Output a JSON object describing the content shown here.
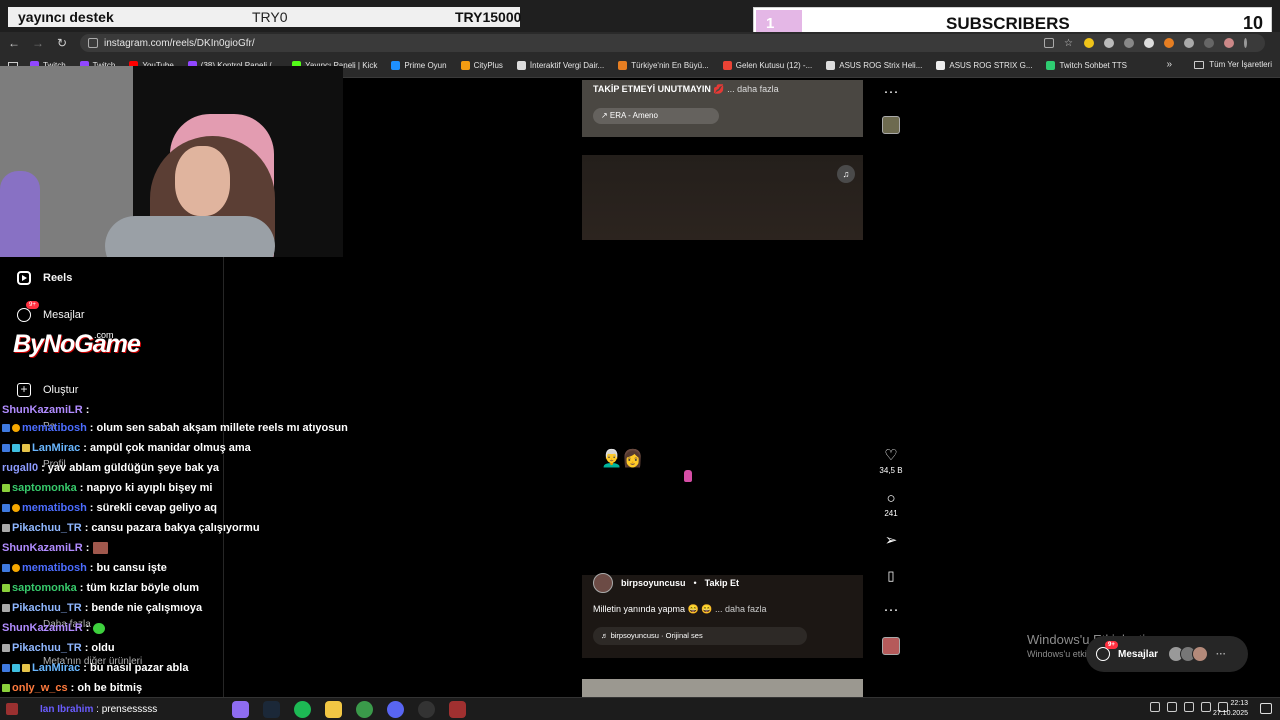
{
  "browser": {
    "url": "instagram.com/reels/DKIn0gioGfr/",
    "bookmarks": [
      "Twitch",
      "Twitch",
      "YouTube",
      "(38) Kontrol Paneli /...",
      "Yayıncı Paneli | Kick",
      "Prime Oyun",
      "CityPlus",
      "İnteraktif Vergi Dair...",
      "Türkiye'nin En Büyü...",
      "Gelen Kutusu (12) -...",
      "ASUS ROG Strix Heli...",
      "ASUS ROG STRIX G...",
      "Twitch Sohbet TTS"
    ],
    "all_bookmarks": "Tüm Yer İşaretleri",
    "more": "»"
  },
  "overlay": {
    "donor_label": "yayıncı destek",
    "donor_amount": "TRY0",
    "donor_goal": "TRY15000",
    "subs_count_left": "1",
    "subs_label": "SUBSCRIBERS",
    "subs_count_right": "10"
  },
  "sidenav": {
    "reels": "Reels",
    "messages": "Mesajlar",
    "messages_badge": "9+",
    "create": "Oluştur",
    "profile": "Profil",
    "more": "Daha fazla",
    "meta": "Meta'nın diğer ürünleri"
  },
  "logo": {
    "main": "ByNoGame",
    "suffix": ".com"
  },
  "chat": [
    {
      "user": "ShunKazamiLR",
      "msg": ":",
      "color": "#b18cff"
    },
    {
      "user": "mematibosh",
      "msg": ": olum sen sabah akşam millete reels mı atıyosun",
      "color": "#4c6dff"
    },
    {
      "user": "LanMirac",
      "msg": ": ampül çok manidar olmuş ama",
      "color": "#6ab7ff"
    },
    {
      "user": "rugall0",
      "msg": ": yav ablam güldüğün şeye bak ya",
      "color": "#8d9bff"
    },
    {
      "user": "saptomonka",
      "msg": ": napıyo ki ayıplı bişey mi",
      "color": "#37c96b"
    },
    {
      "user": "mematibosh",
      "msg": ": sürekli cevap geliyo aq",
      "color": "#4c6dff"
    },
    {
      "user": "Pikachuu_TR",
      "msg": ": cansu pazara bakya çalışıyormu",
      "color": "#8fb7ff"
    },
    {
      "user": "ShunKazamiLR",
      "msg": ":",
      "color": "#b18cff"
    },
    {
      "user": "mematibosh",
      "msg": ": bu cansu işte",
      "color": "#4c6dff"
    },
    {
      "user": "saptomonka",
      "msg": ": tüm kızlar böyle olum",
      "color": "#37c96b"
    },
    {
      "user": "Pikachuu_TR",
      "msg": ": bende nie çalışmıoya",
      "color": "#8fb7ff"
    },
    {
      "user": "ShunKazamiLR",
      "msg": ":",
      "color": "#b18cff"
    },
    {
      "user": "Pikachuu_TR",
      "msg": ": oldu",
      "color": "#8fb7ff"
    },
    {
      "user": "LanMirac",
      "msg": ": bu nasıl pazar abla",
      "color": "#6ab7ff"
    },
    {
      "user": "only_w_cs",
      "msg": ": oh be bitmiş",
      "color": "#ff7a3d"
    }
  ],
  "reel_prev": {
    "caption": "TAKİP ETMEYİ UNUTMAYIN 💋",
    "more": "... daha fazla",
    "song": "↗ ERA - Ameno"
  },
  "reel": {
    "emoji": "👨‍🦳👩",
    "author": "birpsoyuncusu",
    "dot": "•",
    "follow": "Takip Et",
    "caption": "Milletin yanında yapma 😄 😄",
    "more": "... daha fazla",
    "audio": "♬ birpsoyuncusu · Orijinal ses",
    "likes": "34,5 B",
    "comments": "241"
  },
  "activation": {
    "title": "Windows'u Etkinleştir",
    "subtitle": "Windows'u etkinleştirmek için Ayarlar'a gidin."
  },
  "messages_pill": {
    "label": "Mesajlar",
    "badge": "9+"
  },
  "taskbar": {
    "user": "Ian Ibrahim",
    "text": ": prensesssss",
    "time": "22:13",
    "date": "27.10.2025"
  },
  "colors": {
    "accent": "#ff3040",
    "chrome": "#2a2a2a"
  }
}
